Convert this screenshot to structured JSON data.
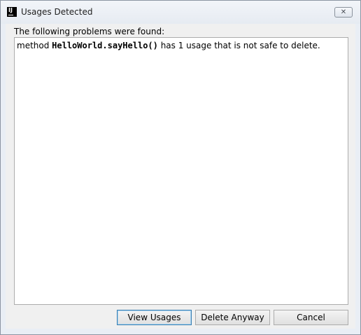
{
  "window": {
    "title": "Usages Detected",
    "app_icon_text": "IJ",
    "close_glyph": "✕"
  },
  "dialog": {
    "heading": "The following problems were found:",
    "message": {
      "prefix": "method ",
      "code": "HelloWorld.sayHello()",
      "suffix": " has 1 usage that is not safe to delete."
    }
  },
  "buttons": {
    "view_usages": "View Usages",
    "delete_anyway": "Delete Anyway",
    "cancel": "Cancel"
  },
  "icons": {
    "app": "intellij-icon",
    "close": "close-icon"
  }
}
